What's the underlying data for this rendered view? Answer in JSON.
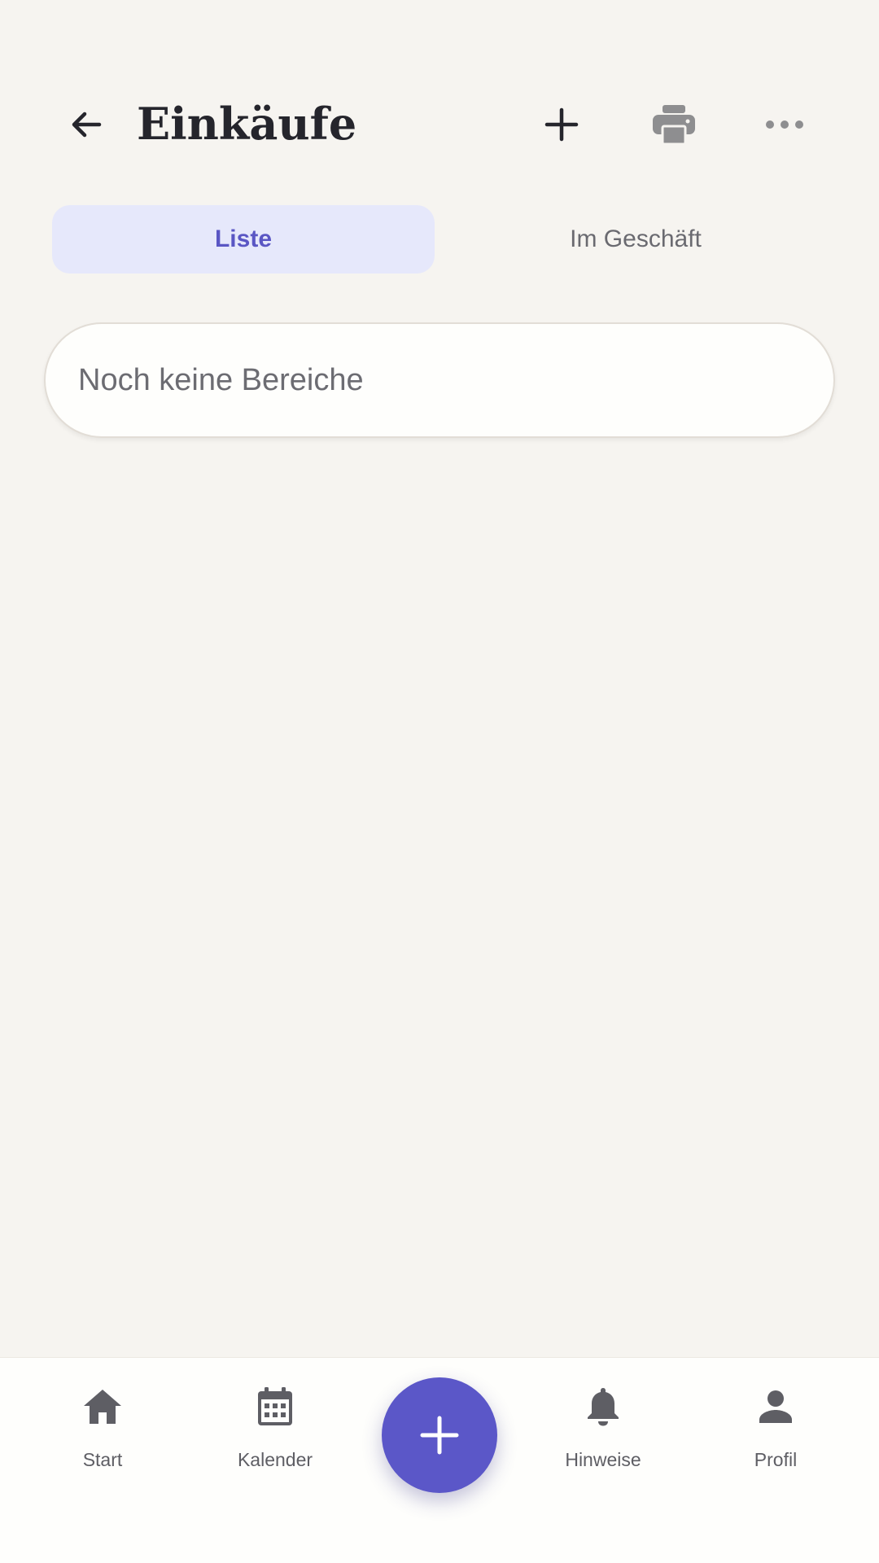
{
  "header": {
    "title": "Einkäufe",
    "back_icon": "arrow-left-icon",
    "add_icon": "plus-icon",
    "print_icon": "printer-icon",
    "more_icon": "more-horizontal-icon"
  },
  "tabs": [
    {
      "label": "Liste",
      "active": true
    },
    {
      "label": "Im Geschäft",
      "active": false
    }
  ],
  "empty_state": {
    "text": "Noch keine Bereiche"
  },
  "bottom_nav": {
    "items": [
      {
        "label": "Start",
        "icon": "home-icon"
      },
      {
        "label": "Kalender",
        "icon": "calendar-icon"
      },
      {
        "label": "Hinweise",
        "icon": "bell-icon"
      },
      {
        "label": "Profil",
        "icon": "person-icon"
      }
    ],
    "fab_icon": "plus-icon"
  },
  "colors": {
    "background": "#f6f4f0",
    "accent": "#5b57c8",
    "active_tab_bg": "#e6e8fb",
    "active_tab_text": "#5a56c4",
    "icon_muted": "#5e5e64"
  }
}
